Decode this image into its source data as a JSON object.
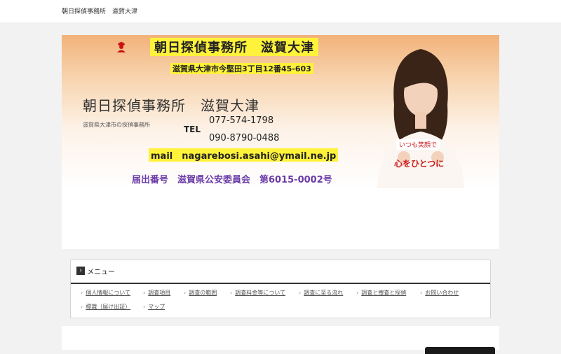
{
  "header": {
    "site_name": "朝日探偵事務所　滋賀大津"
  },
  "banner": {
    "title": "朝日探偵事務所　滋賀大津",
    "address": "滋賀県大津市今堅田3丁目12番45-603",
    "tel_label": "TEL",
    "tel_1": "077-574-1798",
    "tel_2": "090-8790-0488",
    "mail": "mail　nagarebosi.asahi@ymail.ne.jp",
    "license": "届出番号　滋賀県公安委員会　第6015-0002号",
    "smile_badge": "いつも笑顔で",
    "slogan": "心をひとつに"
  },
  "site": {
    "title": "朝日探偵事務所　滋賀大津",
    "tagline": "滋賀県大津市の探偵事務所"
  },
  "menu": {
    "title": "メニュー",
    "items": [
      {
        "label": "個人情報について"
      },
      {
        "label": "調査項目"
      },
      {
        "label": "調査の範囲"
      },
      {
        "label": "調査料金等について"
      },
      {
        "label": "調査に至る流れ"
      },
      {
        "label": "調査と捜査と探偵"
      },
      {
        "label": "お問い合わせ"
      },
      {
        "label": "標識（届け出証）"
      },
      {
        "label": "マップ"
      }
    ]
  },
  "colors": {
    "highlight": "#fff23a",
    "license_text": "#6a3aa8",
    "slogan_text": "#cc1a1a"
  }
}
